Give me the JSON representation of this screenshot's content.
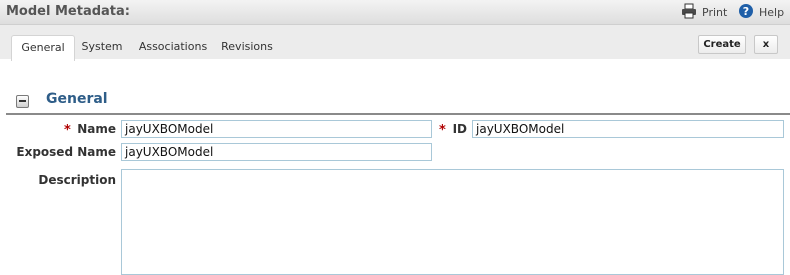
{
  "header": {
    "title": "Model Metadata:",
    "print_label": "Print",
    "help_label": "Help"
  },
  "tabs": [
    {
      "label": "General",
      "active": true
    },
    {
      "label": "System",
      "active": false
    },
    {
      "label": "Associations",
      "active": false
    },
    {
      "label": "Revisions",
      "active": false
    }
  ],
  "buttons": {
    "create_label": "Create",
    "close_label": "x"
  },
  "section": {
    "title": "General"
  },
  "form": {
    "required_marker": "*",
    "name": {
      "label": "Name",
      "value": "jayUXBOModel",
      "required": true
    },
    "id": {
      "label": "ID",
      "value": "jayUXBOModel",
      "required": true
    },
    "exposed_name": {
      "label": "Exposed Name",
      "value": "jayUXBOModel"
    },
    "description": {
      "label": "Description",
      "value": ""
    }
  },
  "colors": {
    "accent": "#2e5d88",
    "required": "#b00000",
    "input_border": "#a9c8d8"
  }
}
